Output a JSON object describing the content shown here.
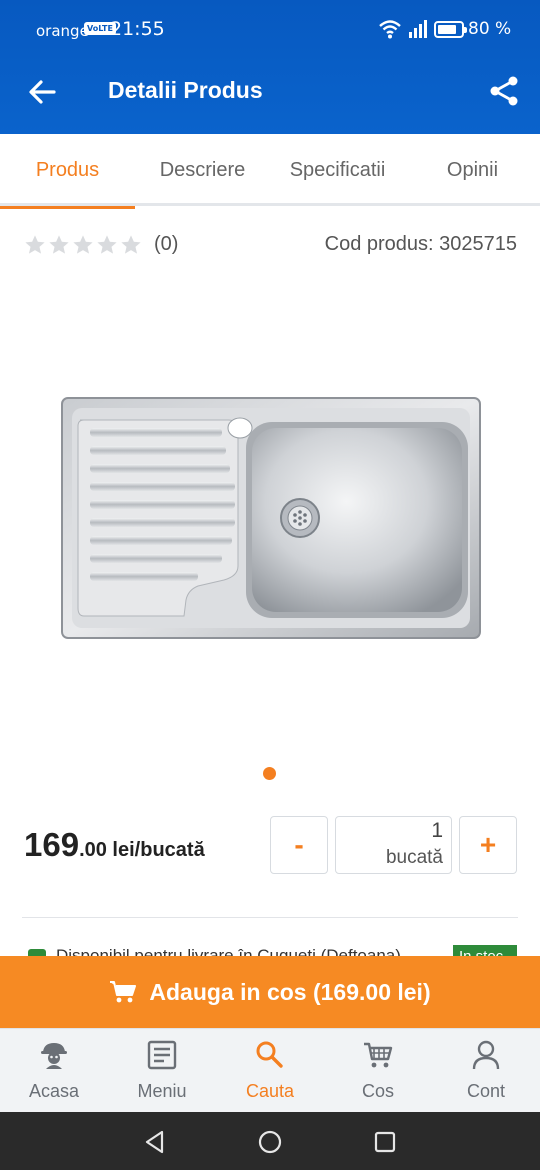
{
  "status_bar": {
    "carrier": "orange",
    "volte": "VoLTE",
    "time": "21:55",
    "battery": "80 %",
    "battery_level": 0.8
  },
  "app_bar": {
    "title": "Detalii Produs",
    "back_icon": "arrow-left-icon",
    "share_icon": "share-icon"
  },
  "tabs": [
    {
      "label": "Produs",
      "active": true
    },
    {
      "label": "Descriere",
      "active": false
    },
    {
      "label": "Specificatii",
      "active": false
    },
    {
      "label": "Opinii",
      "active": false
    }
  ],
  "rating": {
    "stars": 0,
    "max_stars": 5,
    "reviews": "(0)"
  },
  "product": {
    "code": "Cod produs: 3025715",
    "image_icon": "stainless-steel-sink-image",
    "carousel_pages": 1
  },
  "price": {
    "integer": "169",
    "decimal": ".00",
    "unit": " lei/bucată"
  },
  "quantity": {
    "minus": "-",
    "value": "1",
    "unit": "bucată",
    "plus": "+"
  },
  "availability": {
    "text": "Disponibil pentru livrare în Cugueti (Deftoana)",
    "badge": "In stoc"
  },
  "cart_button": {
    "label": "Adauga in cos (169.00 lei)",
    "icon": "cart-icon"
  },
  "bottom_nav": [
    {
      "label": "Acasa",
      "icon": "home-mascot-icon",
      "active": false
    },
    {
      "label": "Meniu",
      "icon": "menu-list-icon",
      "active": false
    },
    {
      "label": "Cauta",
      "icon": "search-icon",
      "active": true
    },
    {
      "label": "Cos",
      "icon": "cart-icon",
      "active": false
    },
    {
      "label": "Cont",
      "icon": "user-icon",
      "active": false
    }
  ],
  "colors": {
    "primary_blue": "#0a5fc4",
    "accent_orange": "#f47f20",
    "cart_orange": "#f68a23",
    "stock_green": "#2e8b3a"
  }
}
